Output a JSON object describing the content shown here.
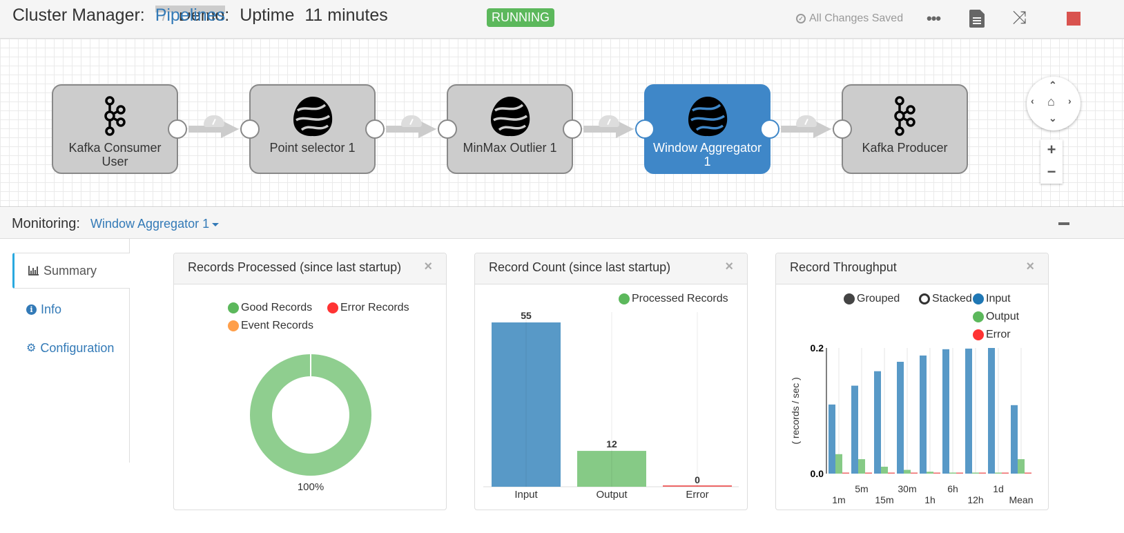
{
  "header": {
    "app_title": "Cluster Manager:",
    "pipelines_link": "Pipelines",
    "separator": "/",
    "pipeline_name": "Demo:",
    "uptime_label": "Uptime",
    "uptime_value": "11 minutes",
    "status_badge": "RUNNING",
    "save_status": "All Changes Saved",
    "more_icon": "ellipsis-icon",
    "doc_icon": "document-icon",
    "shuffle_icon": "shuffle-icon",
    "stop_icon": "stop-icon",
    "colors": {
      "running": "#5cb85c",
      "stop": "#d9534f",
      "link": "#337ab7"
    }
  },
  "pipeline": {
    "nodes": [
      {
        "label": "Kafka Consumer User",
        "icon": "kafka-icon",
        "selected": false
      },
      {
        "label": "Point selector 1",
        "icon": "processor-icon",
        "selected": false
      },
      {
        "label": "MinMax Outlier 1",
        "icon": "processor-icon",
        "selected": false
      },
      {
        "label": "Window Aggregator 1",
        "icon": "processor-icon",
        "selected": true
      },
      {
        "label": "Kafka Producer",
        "icon": "kafka-icon",
        "selected": false
      }
    ],
    "selected_color": "#3f87c8",
    "navigation": {
      "up": "^",
      "down": "v",
      "left": "<",
      "right": ">",
      "home": "⌂",
      "zoom_in": "+",
      "zoom_out": "−"
    }
  },
  "monitoring": {
    "label": "Monitoring:",
    "selected_stage": "Window Aggregator 1",
    "tabs": [
      {
        "label": "Summary",
        "icon": "bar-chart-icon",
        "active": true
      },
      {
        "label": "Info",
        "icon": "info-icon",
        "active": false
      },
      {
        "label": "Configuration",
        "icon": "gear-icon",
        "active": false
      }
    ]
  },
  "panels": {
    "records_processed": {
      "title": "Records Processed (since last startup)",
      "close": "×"
    },
    "record_count": {
      "title": "Record Count (since last startup)",
      "close": "×"
    },
    "record_throughput": {
      "title": "Record Throughput",
      "close": "×"
    }
  },
  "chart_data": [
    {
      "type": "pie",
      "title": "Records Processed (since last startup)",
      "legend": [
        {
          "name": "Good Records",
          "color": "#5cb85c"
        },
        {
          "name": "Error Records",
          "color": "#ff3333"
        },
        {
          "name": "Event Records",
          "color": "#ff9f4a"
        }
      ],
      "slices": [
        {
          "name": "Good Records",
          "value": 100,
          "color": "#8fce8f"
        },
        {
          "name": "Error Records",
          "value": 0,
          "color": "#ff3333"
        },
        {
          "name": "Event Records",
          "value": 0,
          "color": "#ff9f4a"
        }
      ],
      "donut": true,
      "labels": [
        "100%"
      ]
    },
    {
      "type": "bar",
      "title": "Record Count (since last startup)",
      "legend": [
        {
          "name": "Processed Records",
          "color": "#5cb85c"
        }
      ],
      "categories": [
        "Input",
        "Output",
        "Error"
      ],
      "values": [
        55,
        12,
        0
      ],
      "colors": [
        "#5899c7",
        "#86ca86",
        "#ee6666"
      ],
      "ylim": [
        0,
        55
      ]
    },
    {
      "type": "bar",
      "title": "Record Throughput",
      "ylabel": "( records / sec )",
      "legend_modes": [
        {
          "name": "Grouped",
          "selected": true
        },
        {
          "name": "Stacked",
          "selected": false
        }
      ],
      "categories": [
        "1m",
        "5m",
        "15m",
        "30m",
        "1h",
        "6h",
        "12h",
        "1d",
        "Mean"
      ],
      "series": [
        {
          "name": "Input",
          "color": "#5899c7",
          "legend_color": "#1f77b4",
          "values": [
            0.11,
            0.14,
            0.163,
            0.178,
            0.188,
            0.198,
            0.199,
            0.2,
            0.109
          ]
        },
        {
          "name": "Output",
          "color": "#86ca86",
          "legend_color": "#5cb85c",
          "values": [
            0.031,
            0.023,
            0.011,
            0.006,
            0.003,
            0.001,
            0.001,
            0.001,
            0.023
          ]
        },
        {
          "name": "Error",
          "color": "#ee6666",
          "legend_color": "#ff3333",
          "values": [
            0,
            0,
            0,
            0,
            0,
            0,
            0,
            0,
            0
          ]
        }
      ],
      "yticks": [
        "0.0",
        "0.2"
      ],
      "ylim": [
        0,
        0.2
      ]
    }
  ]
}
